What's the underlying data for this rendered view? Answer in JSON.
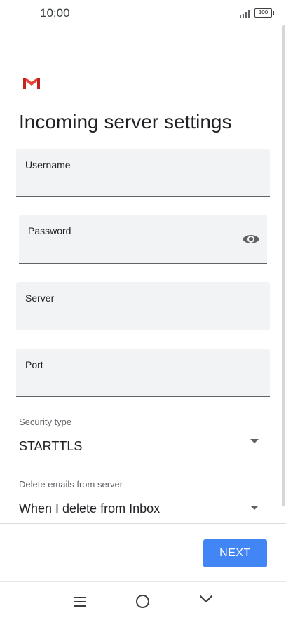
{
  "status_bar": {
    "time": "10:00",
    "battery": "100",
    "signal_icon": "signal-icon",
    "battery_icon": "battery-icon"
  },
  "app": {
    "logo_icon": "gmail-logo-icon",
    "title": "Incoming server settings"
  },
  "fields": {
    "username": {
      "label": "Username",
      "value": ""
    },
    "password": {
      "label": "Password",
      "value": "",
      "toggle_icon": "eye-icon"
    },
    "server": {
      "label": "Server",
      "value": ""
    },
    "port": {
      "label": "Port",
      "value": ""
    }
  },
  "security": {
    "label": "Security type",
    "value": "STARTTLS",
    "icon": "dropdown-arrow-icon"
  },
  "delete_emails": {
    "label": "Delete emails from server",
    "value": "When I delete from Inbox",
    "icon": "dropdown-arrow-icon"
  },
  "actions": {
    "next_label": "NEXT"
  },
  "colors": {
    "accent": "#4285f4",
    "field_bg": "#f1f3f4",
    "gmail_red": "#ea4335"
  },
  "nav": {
    "menu_icon": "menu-icon",
    "home_icon": "home-icon",
    "back_icon": "back-chevron-icon"
  }
}
